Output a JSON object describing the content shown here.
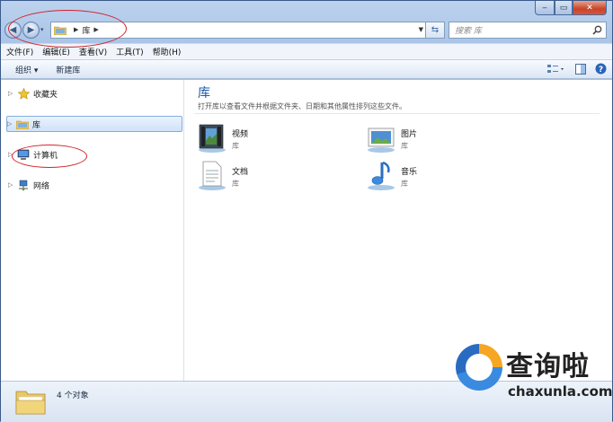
{
  "address": {
    "crumb": "库",
    "search_placeholder": "搜索 库"
  },
  "menu": [
    "文件(F)",
    "编辑(E)",
    "查看(V)",
    "工具(T)",
    "帮助(H)"
  ],
  "toolbar": {
    "organize": "组织 ▾",
    "new_library": "新建库"
  },
  "nav": {
    "favorites": "收藏夹",
    "libraries": "库",
    "computer": "计算机",
    "network": "网络"
  },
  "main": {
    "title": "库",
    "description": "打开库以查看文件并根据文件夹、日期和其他属性排列这些文件。",
    "libraries": [
      {
        "name": "视频",
        "type": "库",
        "icon": "video-library-icon"
      },
      {
        "name": "图片",
        "type": "库",
        "icon": "pictures-library-icon"
      },
      {
        "name": "文档",
        "type": "库",
        "icon": "documents-library-icon"
      },
      {
        "name": "音乐",
        "type": "库",
        "icon": "music-library-icon"
      }
    ]
  },
  "status": {
    "count": "4 个对象"
  },
  "watermark": {
    "title": "查询啦",
    "site": "chaxunla.com"
  }
}
